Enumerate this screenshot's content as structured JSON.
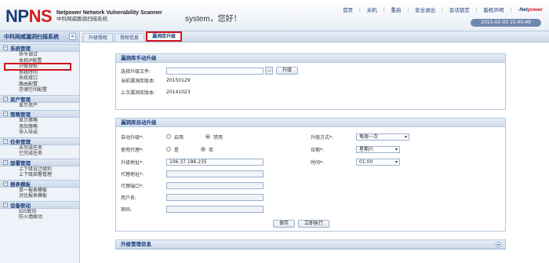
{
  "header": {
    "logo_a": "NP",
    "logo_b": "NS",
    "product_en": "Netpower Network Vulnerability Scanner",
    "product_cn": "中科网威脆弱扫描系统",
    "greeting": "system，您好！",
    "nav": [
      "首页",
      "关机",
      "重启",
      "安全退出",
      "会话锁定",
      "版权声明"
    ],
    "brand_a": "Net",
    "brand_b": "power",
    "datetime": "2015-02-03 15:40:49"
  },
  "sidebar": {
    "title": "中科网威漏洞扫描系统",
    "collapse": "«",
    "groups": [
      {
        "title": "系统管理",
        "items": [
          "命令调试",
          "本机IP配置",
          "升级授权",
          "系统时间",
          "系统接口",
          "路由配置",
          "存储空间配置"
        ]
      },
      {
        "title": "资产管理",
        "items": [
          "显示资产"
        ]
      },
      {
        "title": "策略管理",
        "items": [
          "显示策略",
          "添加策略",
          "导入导出"
        ]
      },
      {
        "title": "任务管理",
        "items": [
          "未完成任务",
          "已完成任务"
        ]
      },
      {
        "title": "部署管理",
        "items": [
          "上下级设计级别",
          "上下级部署管理"
        ]
      },
      {
        "title": "报表模板",
        "items": [
          "单一报表模板",
          "对比报表模板"
        ]
      },
      {
        "title": "设备联动",
        "items": [
          "IDS联动",
          "防火墙联动"
        ]
      }
    ]
  },
  "tabs": [
    "升级授权",
    "授权信息",
    "漏洞库升级"
  ],
  "manual": {
    "title": "漏洞库手动升级",
    "file_label": "选择升级文件:",
    "browse": "…",
    "upgrade_btn": "升级",
    "current_label": "当前漏洞库版本:",
    "current_value": "20150129",
    "last_label": "上次漏洞库版本:",
    "last_value": "20141023"
  },
  "auto": {
    "title": "漏洞库自动升级",
    "auto_label": "自动升级*:",
    "enable": "启用",
    "disable": "禁用",
    "proxy_label": "使用代理*:",
    "yes": "是",
    "no": "否",
    "addr_label": "升级地址*:",
    "addr_value": "106.37.186.235",
    "proxy_addr_label": "代理地址*:",
    "proxy_port_label": "代理端口*:",
    "user_label": "用户名:",
    "pass_label": "密码:",
    "mode_label": "升级方式*:",
    "mode_value": "每周一次",
    "day_label": "日期*:",
    "day_value": "星期六",
    "time_label": "时间*:",
    "time_value": "01:00",
    "save_btn": "保存",
    "run_btn": "立即执行"
  },
  "info": {
    "title": "升级管理信息"
  }
}
